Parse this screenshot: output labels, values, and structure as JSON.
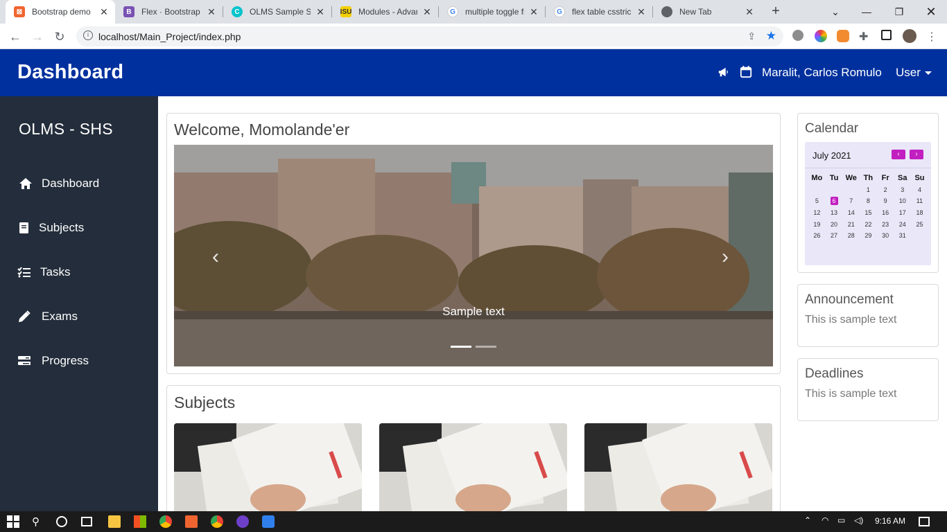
{
  "browser": {
    "tabs": [
      {
        "title": "Bootstrap demo",
        "icon": "bootstrap-demo-icon",
        "color": "#f0652f"
      },
      {
        "title": "Flex · Bootstrap v",
        "icon": "bootstrap-icon",
        "color": "#7952b3"
      },
      {
        "title": "OLMS Sample Stu",
        "icon": "canva-icon",
        "color": "#00c4cc"
      },
      {
        "title": "Modules - Advan",
        "icon": "modules-icon",
        "color": "#f5d000"
      },
      {
        "title": "multiple toggle fi",
        "icon": "google-icon",
        "color": "#4285f4"
      },
      {
        "title": "flex table csstrick",
        "icon": "google-icon",
        "color": "#4285f4"
      },
      {
        "title": "New Tab",
        "icon": "chrome-icon",
        "color": "#5f6368"
      }
    ],
    "url": "localhost/Main_Project/index.php"
  },
  "header": {
    "title": "Dashboard",
    "user_name": "Maralit, Carlos Romulo",
    "user_menu": "User"
  },
  "sidebar": {
    "brand": "OLMS - SHS",
    "items": [
      {
        "label": "Dashboard",
        "icon": "home-icon"
      },
      {
        "label": "Subjects",
        "icon": "book-icon"
      },
      {
        "label": "Tasks",
        "icon": "tasks-icon"
      },
      {
        "label": "Exams",
        "icon": "pen-icon"
      },
      {
        "label": "Progress",
        "icon": "progress-icon"
      }
    ]
  },
  "welcome": {
    "title": "Welcome, Momolande'er",
    "carousel_caption": "Sample text"
  },
  "subjects": {
    "title": "Subjects"
  },
  "calendar": {
    "title": "Calendar",
    "month": "July 2021",
    "days_of_week": [
      "Mo",
      "Tu",
      "We",
      "Th",
      "Fr",
      "Sa",
      "Su"
    ],
    "weeks": [
      [
        "",
        "",
        "",
        "1",
        "2",
        "3",
        "4"
      ],
      [
        "5",
        "6",
        "7",
        "8",
        "9",
        "10",
        "11"
      ],
      [
        "12",
        "13",
        "14",
        "15",
        "16",
        "17",
        "18"
      ],
      [
        "19",
        "20",
        "21",
        "22",
        "23",
        "24",
        "25"
      ],
      [
        "26",
        "27",
        "28",
        "29",
        "30",
        "31",
        ""
      ]
    ],
    "today": "6"
  },
  "announcement": {
    "title": "Announcement",
    "text": "This is sample text"
  },
  "deadlines": {
    "title": "Deadlines",
    "text": "This is sample text"
  },
  "taskbar": {
    "time": "9:16 AM"
  }
}
